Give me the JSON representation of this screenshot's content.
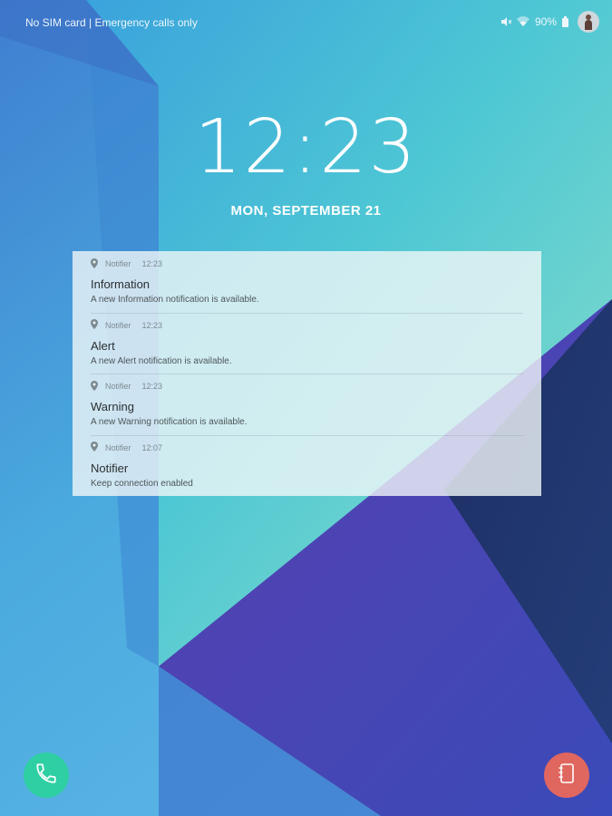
{
  "status_bar": {
    "carrier_text": "No SIM card | Emergency calls only",
    "battery_percent": "90%",
    "icons": [
      "mute-icon",
      "wifi-icon",
      "battery-icon",
      "avatar"
    ]
  },
  "lock_screen": {
    "time": "12:23",
    "date": "MON, SEPTEMBER 21"
  },
  "notifications": [
    {
      "app": "Notifier",
      "time": "12:23",
      "title": "Information",
      "text": "A new Information notification is available."
    },
    {
      "app": "Notifier",
      "time": "12:23",
      "title": "Alert",
      "text": "A new Alert notification is available."
    },
    {
      "app": "Notifier",
      "time": "12:23",
      "title": "Warning",
      "text": "A new Warning notification is available."
    },
    {
      "app": "Notifier",
      "time": "12:07",
      "title": "Notifier",
      "text": "Keep connection enabled"
    }
  ],
  "shortcuts": {
    "left": "phone-icon",
    "right": "contacts-icon"
  },
  "colors": {
    "phone_button": "#2ecfa3",
    "contacts_button": "#e0675f",
    "wallpaper_cyan": "#5fd3d0",
    "wallpaper_navy": "#1f3566"
  }
}
